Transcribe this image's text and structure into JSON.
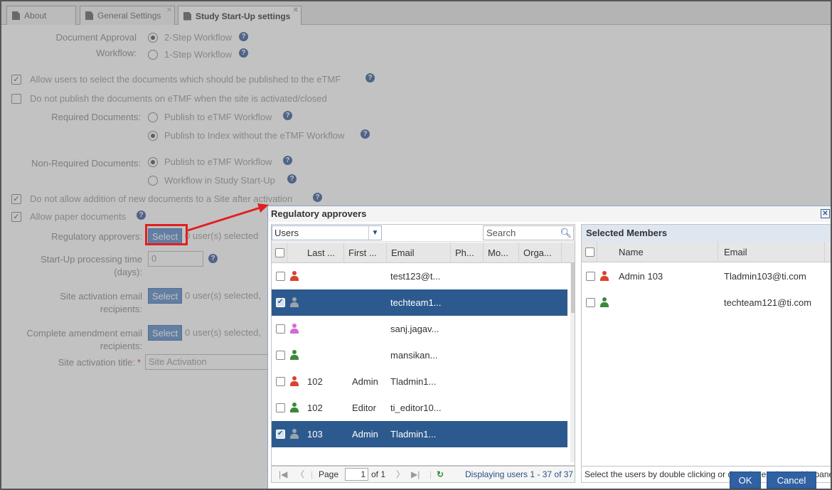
{
  "tabs": [
    {
      "label": "About"
    },
    {
      "label": "General Settings"
    },
    {
      "label": "Study Start-Up settings"
    }
  ],
  "form": {
    "doc_approval_label": "Document Approval",
    "doc_approval_label2": "Workflow:",
    "doc_approval_options": [
      "2-Step Workflow",
      "1-Step Workflow"
    ],
    "allow_select_docs": "Allow users to select the documents which should be published to the eTMF",
    "not_publish": "Do not publish the documents on eTMF when the site is activated/closed",
    "required_docs_label": "Required Documents:",
    "required_docs_options": [
      "Publish to eTMF Workflow",
      "Publish to Index without the eTMF Workflow"
    ],
    "nonrequired_docs_label": "Non-Required Documents:",
    "nonrequired_docs_options": [
      "Publish to eTMF Workflow",
      "Workflow in Study Start-Up"
    ],
    "no_new_docs": "Do not allow addition of new documents to a Site after activation",
    "allow_paper": "Allow paper documents",
    "reg_approvers_label": "Regulatory approvers:",
    "select_label": "Select",
    "reg_approvers_value": "0 user(s) selected",
    "startup_time_label": "Start-Up processing time",
    "startup_time_label2": "(days):",
    "startup_time_value": "0",
    "site_email_label": "Site activation email",
    "site_email_label2": "recipients:",
    "site_email_value": "0 user(s) selected,",
    "amend_email_label": "Complete amendment email",
    "amend_email_label2": "recipients:",
    "amend_email_value": "0 user(s) selected,",
    "site_title_label": "Site activation title:",
    "required_mark": "*",
    "site_title_value": "Site Activation"
  },
  "dialog": {
    "title": "Regulatory approvers",
    "users_combo": "Users",
    "search_placeholder": "Search",
    "columns": [
      "Last ...",
      "First ...",
      "Email",
      "Ph...",
      "Mo...",
      "Orga..."
    ],
    "rows": [
      {
        "last": "",
        "first": "",
        "email": "test123@t...",
        "color": "#d9432f",
        "selected": false
      },
      {
        "last": "",
        "first": "",
        "email": "techteam1...",
        "color": "#9aa3ad",
        "selected": true
      },
      {
        "last": "",
        "first": "",
        "email": "sanj.jagav...",
        "color": "#d46ad4",
        "selected": false
      },
      {
        "last": "",
        "first": "",
        "email": "mansikan...",
        "color": "#3a8a3a",
        "selected": false
      },
      {
        "last": "102",
        "first": "Admin",
        "email": "Tladmin1...",
        "color": "#d9432f",
        "selected": false
      },
      {
        "last": "102",
        "first": "Editor",
        "email": "ti_editor10...",
        "color": "#3a8a3a",
        "selected": false
      },
      {
        "last": "103",
        "first": "Admin",
        "email": "Tladmin1...",
        "color": "#9aa3ad",
        "selected": true
      }
    ],
    "pager": {
      "page_label": "Page",
      "page_value": "1",
      "of_label": "of 1",
      "displaying": "Displaying users 1 - 37 of 37"
    },
    "selected_title": "Selected Members",
    "selected_columns": [
      "Name",
      "Email"
    ],
    "selected_rows": [
      {
        "name": "Admin 103",
        "email": "Tladmin103@ti.com",
        "color": "#d9432f"
      },
      {
        "name": "",
        "email": "techteam121@ti.com",
        "color": "#3a8a3a"
      }
    ],
    "hint": "Select the users by double clicking or drag the entries to this pane.",
    "ok": "OK",
    "cancel": "Cancel"
  },
  "colors": {
    "accent": "#2f61a3",
    "selected_row": "#2d5a8e",
    "annotation": "#e02020"
  }
}
